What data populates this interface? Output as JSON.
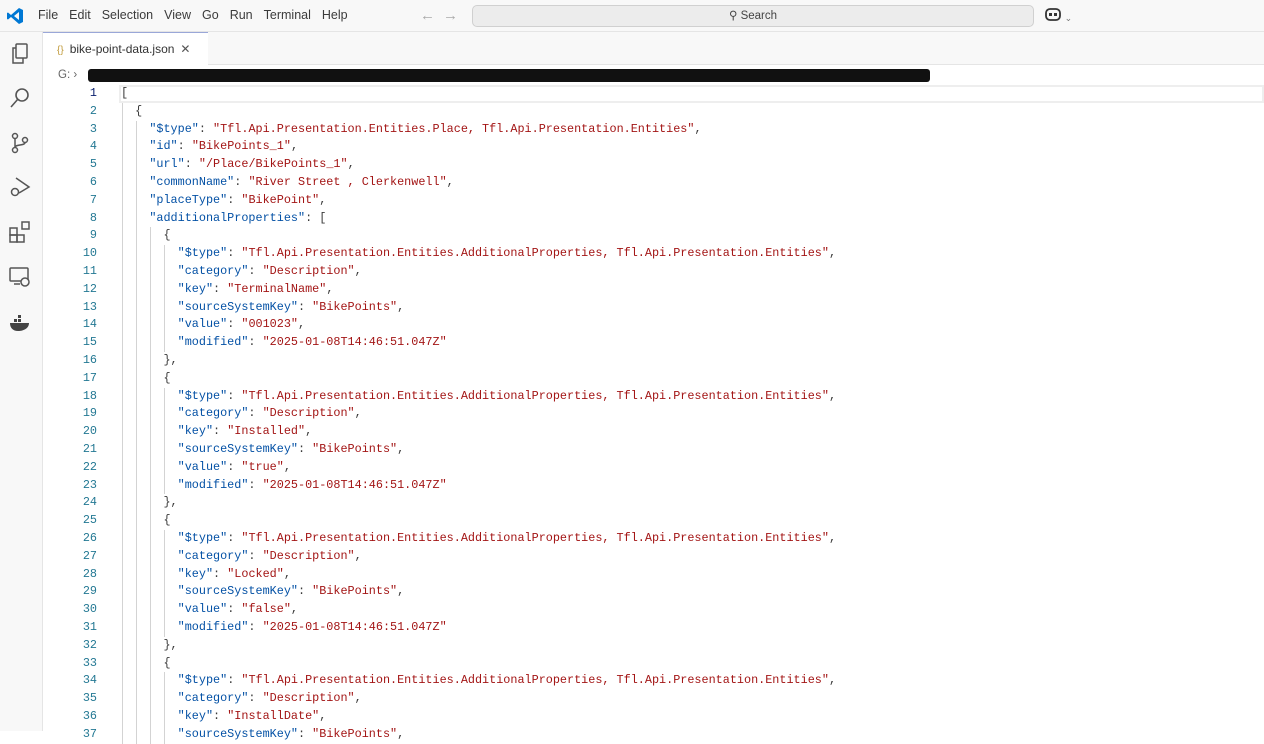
{
  "app": {
    "menu": [
      "File",
      "Edit",
      "Selection",
      "View",
      "Go",
      "Run",
      "Terminal",
      "Help"
    ],
    "search_label": "Search"
  },
  "tab": {
    "label": "bike-point-data.json"
  },
  "breadcrumb": {
    "drive": "G:"
  },
  "editor": {
    "lines": [
      {
        "i": 0,
        "p": "["
      },
      {
        "i": 1,
        "p": "{"
      },
      {
        "i": 2,
        "key": "\"$type\"",
        "val": "\"Tfl.Api.Presentation.Entities.Place, Tfl.Api.Presentation.Entities\"",
        "end": ","
      },
      {
        "i": 2,
        "key": "\"id\"",
        "val": "\"BikePoints_1\"",
        "end": ","
      },
      {
        "i": 2,
        "key": "\"url\"",
        "val": "\"/Place/BikePoints_1\"",
        "end": ","
      },
      {
        "i": 2,
        "key": "\"commonName\"",
        "val": "\"River Street , Clerkenwell\"",
        "end": ","
      },
      {
        "i": 2,
        "key": "\"placeType\"",
        "val": "\"BikePoint\"",
        "end": ","
      },
      {
        "i": 2,
        "key": "\"additionalProperties\"",
        "pv": "["
      },
      {
        "i": 3,
        "p": "{"
      },
      {
        "i": 4,
        "key": "\"$type\"",
        "val": "\"Tfl.Api.Presentation.Entities.AdditionalProperties, Tfl.Api.Presentation.Entities\"",
        "end": ","
      },
      {
        "i": 4,
        "key": "\"category\"",
        "val": "\"Description\"",
        "end": ","
      },
      {
        "i": 4,
        "key": "\"key\"",
        "val": "\"TerminalName\"",
        "end": ","
      },
      {
        "i": 4,
        "key": "\"sourceSystemKey\"",
        "val": "\"BikePoints\"",
        "end": ","
      },
      {
        "i": 4,
        "key": "\"value\"",
        "val": "\"001023\"",
        "end": ","
      },
      {
        "i": 4,
        "key": "\"modified\"",
        "val": "\"2025-01-08T14:46:51.047Z\"",
        "end": ""
      },
      {
        "i": 3,
        "p": "},"
      },
      {
        "i": 3,
        "p": "{"
      },
      {
        "i": 4,
        "key": "\"$type\"",
        "val": "\"Tfl.Api.Presentation.Entities.AdditionalProperties, Tfl.Api.Presentation.Entities\"",
        "end": ","
      },
      {
        "i": 4,
        "key": "\"category\"",
        "val": "\"Description\"",
        "end": ","
      },
      {
        "i": 4,
        "key": "\"key\"",
        "val": "\"Installed\"",
        "end": ","
      },
      {
        "i": 4,
        "key": "\"sourceSystemKey\"",
        "val": "\"BikePoints\"",
        "end": ","
      },
      {
        "i": 4,
        "key": "\"value\"",
        "val": "\"true\"",
        "end": ","
      },
      {
        "i": 4,
        "key": "\"modified\"",
        "val": "\"2025-01-08T14:46:51.047Z\"",
        "end": ""
      },
      {
        "i": 3,
        "p": "},"
      },
      {
        "i": 3,
        "p": "{"
      },
      {
        "i": 4,
        "key": "\"$type\"",
        "val": "\"Tfl.Api.Presentation.Entities.AdditionalProperties, Tfl.Api.Presentation.Entities\"",
        "end": ","
      },
      {
        "i": 4,
        "key": "\"category\"",
        "val": "\"Description\"",
        "end": ","
      },
      {
        "i": 4,
        "key": "\"key\"",
        "val": "\"Locked\"",
        "end": ","
      },
      {
        "i": 4,
        "key": "\"sourceSystemKey\"",
        "val": "\"BikePoints\"",
        "end": ","
      },
      {
        "i": 4,
        "key": "\"value\"",
        "val": "\"false\"",
        "end": ","
      },
      {
        "i": 4,
        "key": "\"modified\"",
        "val": "\"2025-01-08T14:46:51.047Z\"",
        "end": ""
      },
      {
        "i": 3,
        "p": "},"
      },
      {
        "i": 3,
        "p": "{"
      },
      {
        "i": 4,
        "key": "\"$type\"",
        "val": "\"Tfl.Api.Presentation.Entities.AdditionalProperties, Tfl.Api.Presentation.Entities\"",
        "end": ","
      },
      {
        "i": 4,
        "key": "\"category\"",
        "val": "\"Description\"",
        "end": ","
      },
      {
        "i": 4,
        "key": "\"key\"",
        "val": "\"InstallDate\"",
        "end": ","
      },
      {
        "i": 4,
        "key": "\"sourceSystemKey\"",
        "val": "\"BikePoints\"",
        "end": ","
      }
    ]
  }
}
